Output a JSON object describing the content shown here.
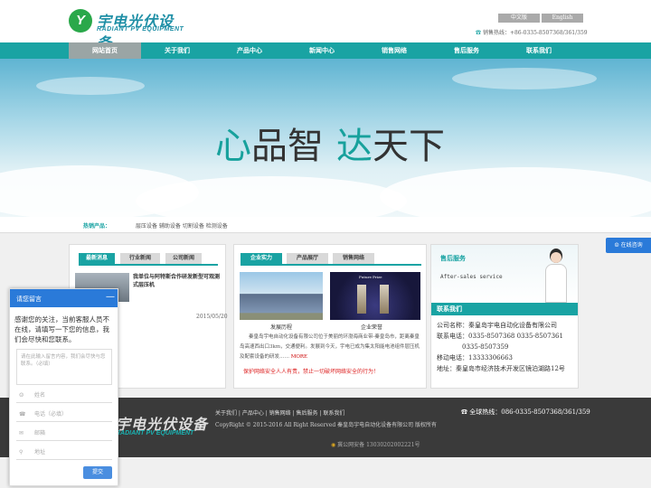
{
  "header": {
    "logo_cn": "宇电光伏设备",
    "logo_en": "RADIANT PV EQUIPMENT",
    "lang_cn": "中文版",
    "lang_en": "English",
    "hotline": "销售热线：+86-0335-8507368/361/359"
  },
  "nav": [
    "网站首页",
    "关于我们",
    "产品中心",
    "新闻中心",
    "销售网络",
    "售后服务",
    "联系我们"
  ],
  "banner": {
    "slogan_a1": "心",
    "slogan_a2": "品智",
    "slogan_b1": "达",
    "slogan_b2": "天下"
  },
  "hot": {
    "title": "热销产品：",
    "items": "层压设备 辅助设备 切割设备 检测设备"
  },
  "news": {
    "tabs": [
      "最新消息",
      "行业新闻",
      "公司新闻"
    ],
    "headline": "我单位与阿特斯合作研发新型可观测式层压机",
    "date": "2015/05/20"
  },
  "company": {
    "tabs": [
      "企业实力",
      "产品展厅",
      "销售网络"
    ],
    "caption1": "发展历程",
    "caption2": "企业荣誉",
    "trophy_label": "Future Prize",
    "text": "秦皇岛宇电自动化设备有限公司位于美丽的环渤海商业带-秦皇岛市，距离秦皇岛高速西出口3km，交通便利。发展到今天，宇电已成为集太阳能电池组件层压机及配套设备的研发……",
    "more": "MORE",
    "notice": "保护网络安全人人有责，禁止一切破坏网络安全的行为！"
  },
  "service": {
    "title_cn": "售后服务",
    "title_en": "After-sales service",
    "contact_title": "联系我们",
    "company_label": "公司名称：",
    "company": "秦皇岛宇电自动化设备有限公司",
    "tel_label": "联系电话：",
    "tel": "0335-8507368  0335-8507361",
    "tel2": "0335-8507359",
    "mobile_label": "移动电话：",
    "mobile": "13333306663",
    "addr_label": "地址：",
    "addr": "秦皇岛市经济技术开发区镜泊湖路12号"
  },
  "footer": {
    "logo_cn": "宇电光伏设备",
    "logo_en": "RADIANT PV EQUIPMENT",
    "links": "关于我们 | 产品中心 | 销售网络 | 售后服务 | 联系我们",
    "copyright": "CopyRight © 2015-2016 All Right Reserved 秦皇岛宇电自动化设备有限公司 版权所有",
    "hotline": "全球热线：086-0335-8507368/361/359",
    "police": "冀公网安备 13030202002221号"
  },
  "chat": {
    "title": "请您留言",
    "intro": "感谢您的关注，当前客服人员不在线，请填写一下您的信息，我们会尽快和您联系。",
    "msg_placeholder": "请在此输入留言内容，我们会尽快与您联系。（必填）",
    "name": "姓名",
    "phone": "电话（必填）",
    "email": "邮箱",
    "address": "地址",
    "submit": "提交"
  },
  "side": {
    "consult": "在线咨询"
  },
  "colors": {
    "accent": "#19a3a3",
    "chat": "#2a7ad9"
  }
}
